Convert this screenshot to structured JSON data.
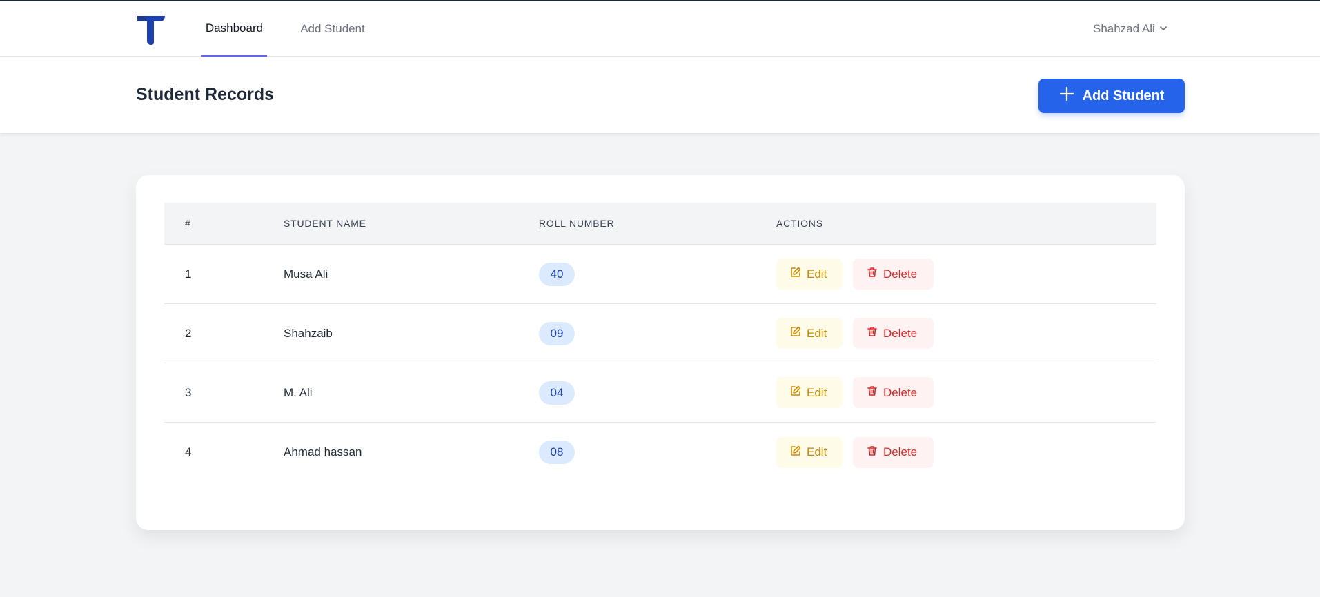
{
  "navbar": {
    "links": [
      {
        "label": "Dashboard",
        "active": true
      },
      {
        "label": "Add Student",
        "active": false
      }
    ],
    "user": {
      "name": "Shahzad Ali",
      "icon": "chevron-down-icon"
    },
    "logo_icon": "t-logo-icon"
  },
  "header": {
    "title": "Student Records",
    "add_button": {
      "label": "Add Student",
      "icon": "plus-icon"
    }
  },
  "table": {
    "columns": [
      "#",
      "STUDENT NAME",
      "ROLL NUMBER",
      "ACTIONS"
    ],
    "rows": [
      {
        "index": "1",
        "name": "Musa Ali",
        "roll": "40",
        "edit_label": "Edit",
        "delete_label": "Delete"
      },
      {
        "index": "2",
        "name": "Shahzaib",
        "roll": "09",
        "edit_label": "Edit",
        "delete_label": "Delete"
      },
      {
        "index": "3",
        "name": "M. Ali",
        "roll": "04",
        "edit_label": "Edit",
        "delete_label": "Delete"
      },
      {
        "index": "4",
        "name": "Ahmad hassan",
        "roll": "08",
        "edit_label": "Edit",
        "delete_label": "Delete"
      }
    ]
  },
  "colors": {
    "primary": "#2563eb",
    "logo": "#1e40af",
    "edit": "#ca8a04",
    "delete": "#dc2626",
    "badge_bg": "#dbeafe"
  }
}
